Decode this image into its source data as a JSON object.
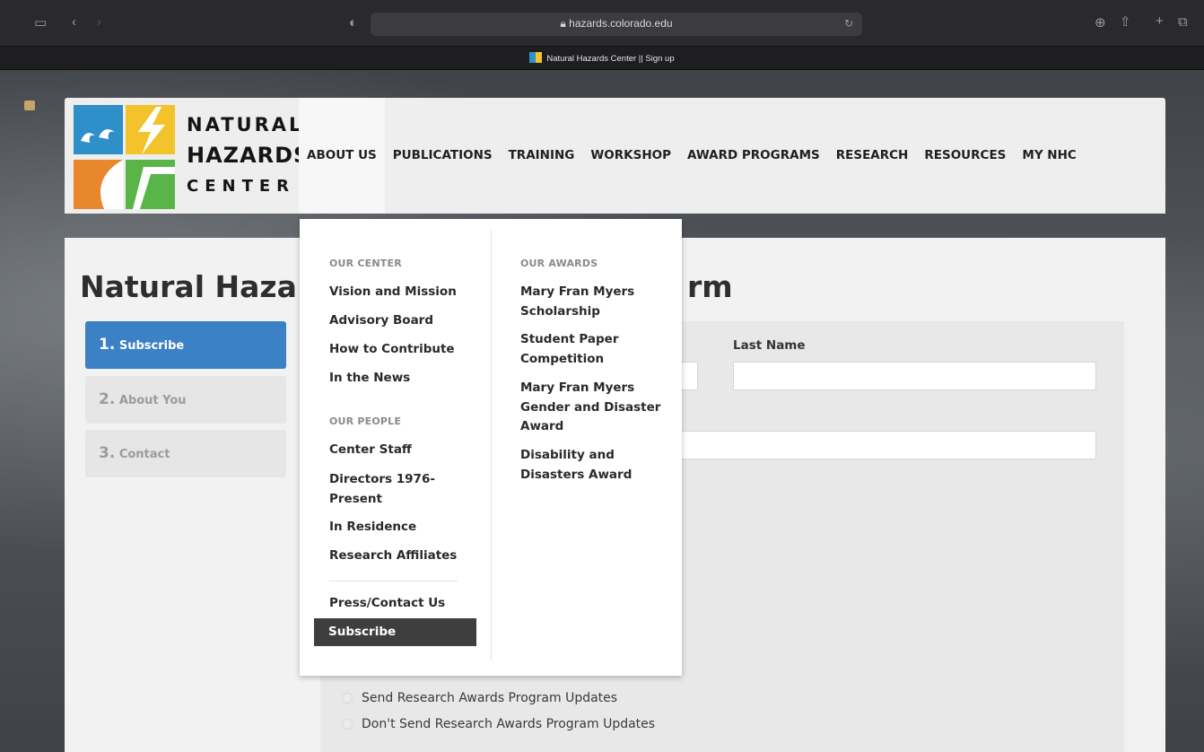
{
  "browser": {
    "url": "hazards.colorado.edu",
    "tab_title": "Natural Hazards Center || Sign up"
  },
  "logo": {
    "line1": "NATURAL",
    "line2": "HAZARDS",
    "line3": "CENTER",
    "tile_colors": [
      "#2f8fc9",
      "#f2c32b",
      "#e8872c",
      "#59b548"
    ]
  },
  "nav": {
    "items": [
      "ABOUT US",
      "PUBLICATIONS",
      "TRAINING",
      "WORKSHOP",
      "AWARD PROGRAMS",
      "RESEARCH",
      "RESOURCES",
      "MY NHC"
    ]
  },
  "page": {
    "title_start": "Natural Haza",
    "title_end": "rm",
    "steps": [
      {
        "num": "1.",
        "label": "Subscribe"
      },
      {
        "num": "2.",
        "label": "About You"
      },
      {
        "num": "3.",
        "label": "Contact"
      }
    ],
    "last_name_label": "Last Name",
    "radios": [
      "Send Research Awards Program Updates",
      "Don't Send Research Awards Program Updates"
    ]
  },
  "dropdown": {
    "our_center_heading": "OUR CENTER",
    "our_center": [
      "Vision and Mission",
      "Advisory Board",
      "How to Contribute",
      "In the News"
    ],
    "our_people_heading": "OUR PEOPLE",
    "our_people": [
      "Center Staff",
      "Directors 1976-Present",
      "In Residence",
      "Research Affiliates"
    ],
    "press_contact": "Press/Contact Us",
    "subscribe": "Subscribe",
    "our_awards_heading": "OUR AWARDS",
    "our_awards": [
      "Mary Fran Myers Scholarship",
      "Student Paper Competition",
      "Mary Fran Myers Gender and Disaster Award",
      "Disability and Disasters Award"
    ]
  },
  "colors": {
    "accent_blue": "#3c80c6",
    "active_menu_bg": "#3e3e3e"
  }
}
